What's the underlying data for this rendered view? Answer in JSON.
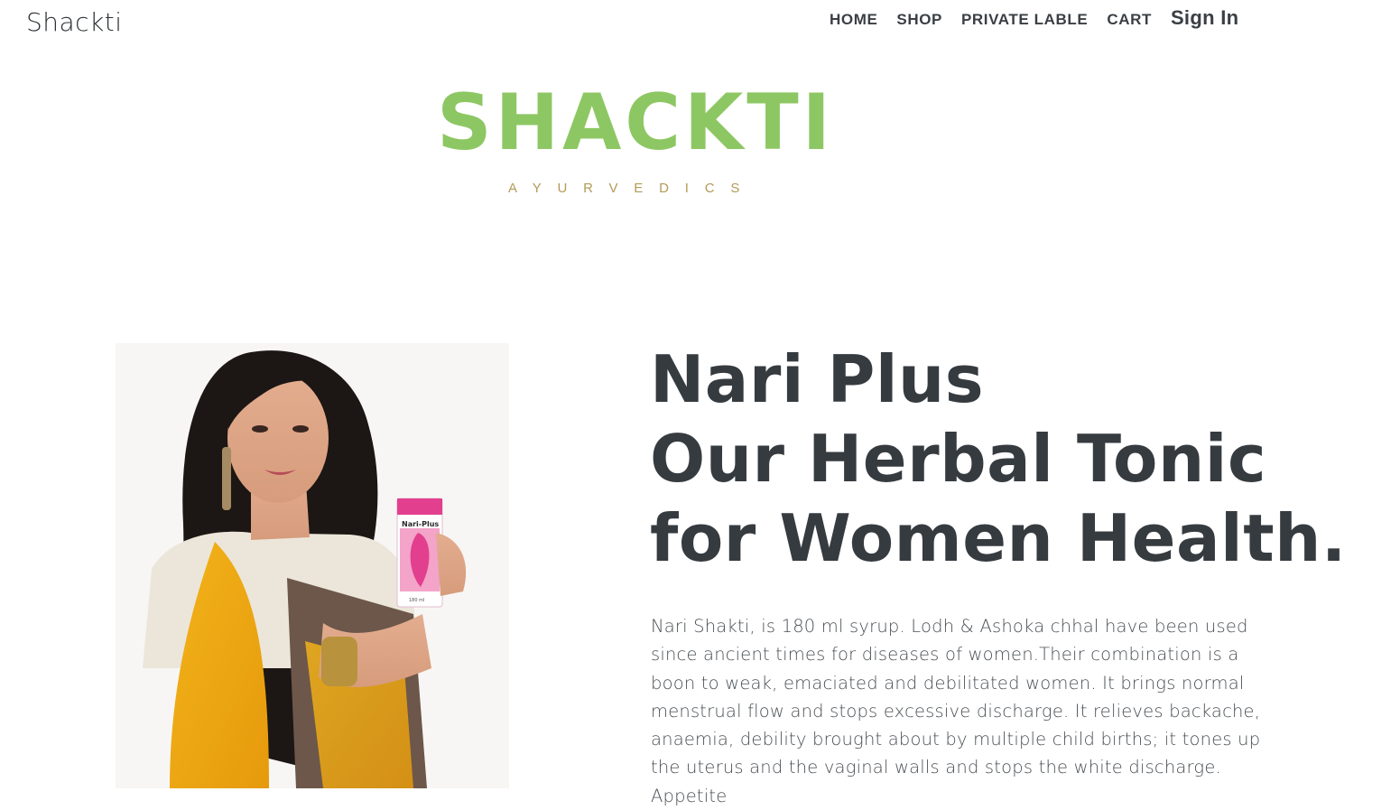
{
  "header": {
    "site_title": "Shackti",
    "nav": [
      {
        "label": "HOME"
      },
      {
        "label": "SHOP"
      },
      {
        "label": "PRIVATE LABLE"
      },
      {
        "label": "CART"
      },
      {
        "label": "Sign In"
      }
    ]
  },
  "logo": {
    "word": "SHACKTI",
    "subtitle": "AYURVEDICS",
    "colors": {
      "word": "#8dc763",
      "subtitle": "#b39a58"
    }
  },
  "hero": {
    "product_box_label": "Nari-Plus",
    "product_box_size": "180 ml",
    "headline_lines": [
      "Nari Plus",
      "Our Herbal Tonic",
      "for Women Health."
    ],
    "description": "Nari Shakti, is 180 ml syrup. Lodh & Ashoka chhal have been used since ancient times for diseases of women.Their combination is a boon to weak, emaciated and debilitated women. It brings normal menstrual flow and stops excessive discharge. It relieves backache, anaemia, debility brought about by multiple child births; it tones up the uterus and the vaginal walls and stops the white discharge. Appetite"
  },
  "colors": {
    "text_dark": "#363b40",
    "background": "#ffffff"
  }
}
